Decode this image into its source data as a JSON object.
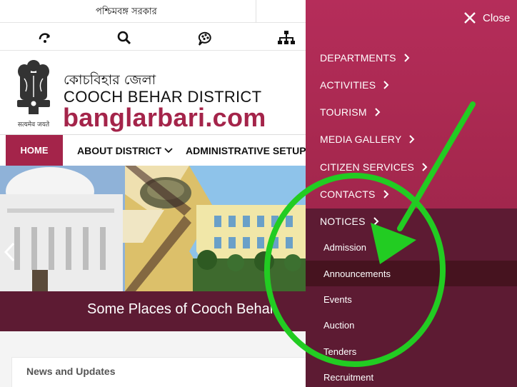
{
  "topbar": {
    "gov_text": "পশ্চিমবঙ্গ সরকার"
  },
  "iconbar": {
    "icons": [
      "skip-icon",
      "search-icon",
      "accessibility-icon",
      "sitemap-icon"
    ]
  },
  "brand": {
    "emblem_caption": "सत्यमेव जयते",
    "name_bengali": "কোচবিহার জেলা",
    "name_english": "COOCH BEHAR DISTRICT",
    "site": "banglarbari.com"
  },
  "nav": {
    "home": "HOME",
    "about": "ABOUT DISTRICT",
    "admin": "ADMINISTRATIVE SETUP"
  },
  "banner": {
    "caption": "Some Places of Cooch Behar"
  },
  "news": {
    "title": "News and Updates"
  },
  "sidemenu": {
    "close_label": "Close",
    "items": [
      {
        "label": "DEPARTMENTS"
      },
      {
        "label": "ACTIVITIES"
      },
      {
        "label": "TOURISM"
      },
      {
        "label": "MEDIA GALLERY"
      },
      {
        "label": "CITIZEN SERVICES"
      },
      {
        "label": "CONTACTS"
      },
      {
        "label": "NOTICES"
      }
    ],
    "notices_sub": [
      {
        "label": "Admission"
      },
      {
        "label": "Announcements"
      },
      {
        "label": "Events"
      },
      {
        "label": "Auction"
      },
      {
        "label": "Tenders"
      },
      {
        "label": "Recruitment"
      }
    ],
    "active_sub": "Announcements"
  },
  "colors": {
    "brand": "#a4244a",
    "menu_bg": "#a7284f",
    "submenu_bg": "#5d1b33",
    "annotation": "#22cc22"
  }
}
